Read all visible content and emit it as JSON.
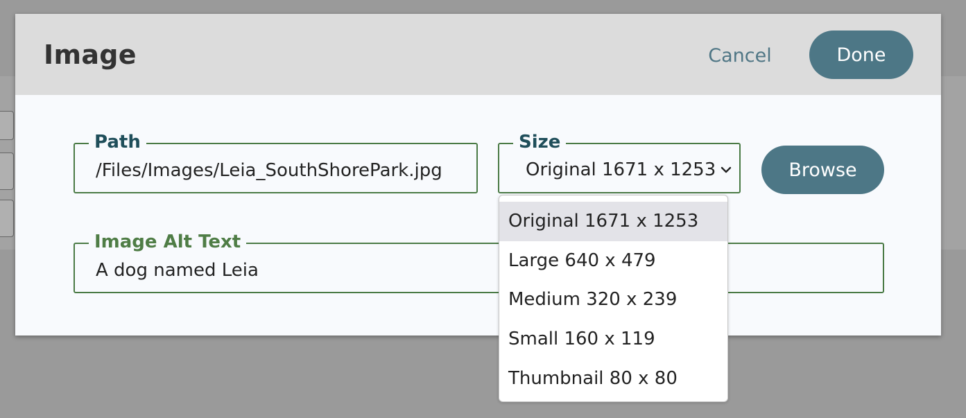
{
  "dialog": {
    "title": "Image",
    "cancel_label": "Cancel",
    "done_label": "Done"
  },
  "path_field": {
    "label": "Path",
    "value": "/Files/Images/Leia_SouthShorePark.jpg"
  },
  "size_field": {
    "label": "Size",
    "value": "Original 1671 x 1253",
    "options": [
      "Original 1671 x 1253",
      "Large 640 x 479",
      "Medium 320 x 239",
      "Small 160 x 119",
      "Thumbnail 80 x 80"
    ],
    "selected_index": 0
  },
  "browse_label": "Browse",
  "alt_field": {
    "label": "Image Alt Text",
    "value": "A dog named Leia"
  },
  "colors": {
    "accent": "#4d7786",
    "field_border": "#4a7a45",
    "header_bg": "#dcdcdc",
    "overlay": "#9a9a9a"
  },
  "icons": {
    "size_dropdown": "chevron-down-icon"
  }
}
